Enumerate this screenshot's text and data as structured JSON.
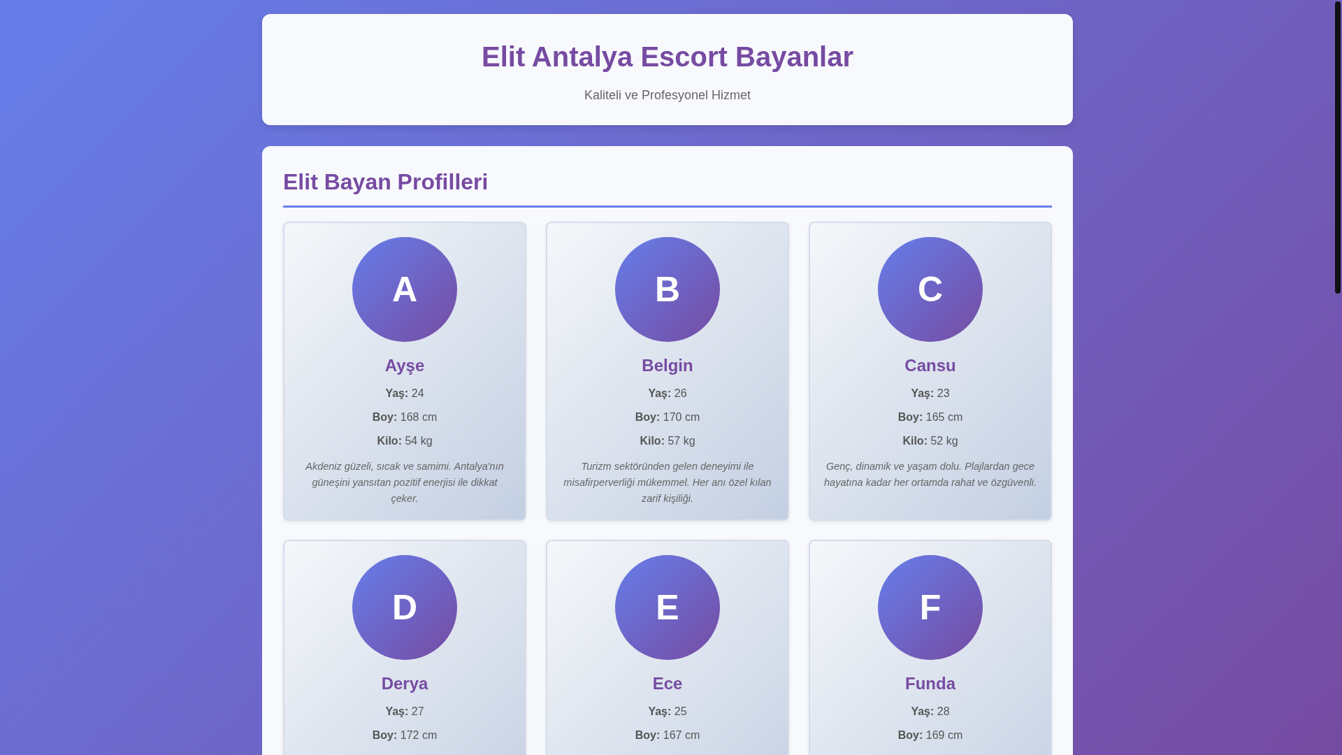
{
  "header": {
    "title": "Elit Antalya Escort Bayanlar",
    "subtitle": "Kaliteli ve Profesyonel Hizmet"
  },
  "section": {
    "title": "Elit Bayan Profilleri",
    "profiles": [
      {
        "initial": "A",
        "name": "Ayşe",
        "stats": [
          "**Yaş:** 24",
          "**Boy:** 168 cm",
          "**Kilo:** 54 kg"
        ],
        "description": "Akdeniz güzeli, sıcak ve samimi. Antalya'nın güneşini yansıtan pozitif enerjisi ile dikkat çeker."
      },
      {
        "initial": "B",
        "name": "Belgin",
        "stats": [
          "**Yaş:** 26",
          "**Boy:** 170 cm",
          "**Kilo:** 57 kg"
        ],
        "description": "Turizm sektöründen gelen deneyimi ile misafirperverliği mükemmel. Her anı özel kılan zarif kişiliği."
      },
      {
        "initial": "C",
        "name": "Cansu",
        "stats": [
          "**Yaş:** 23",
          "**Boy:** 165 cm",
          "**Kilo:** 52 kg"
        ],
        "description": "Genç, dinamik ve yaşam dolu. Plajlardan gece hayatına kadar her ortamda rahat ve özgüvenli."
      },
      {
        "initial": "D",
        "name": "Derya",
        "stats": [
          "**Yaş:** 27",
          "**Boy:** 172 cm"
        ]
      },
      {
        "initial": "E",
        "name": "Ece",
        "stats": [
          "**Yaş:** 25",
          "**Boy:** 167 cm"
        ]
      },
      {
        "initial": "F",
        "name": "Funda",
        "stats": [
          "**Yaş:** 28",
          "**Boy:** 169 cm"
        ]
      }
    ]
  }
}
